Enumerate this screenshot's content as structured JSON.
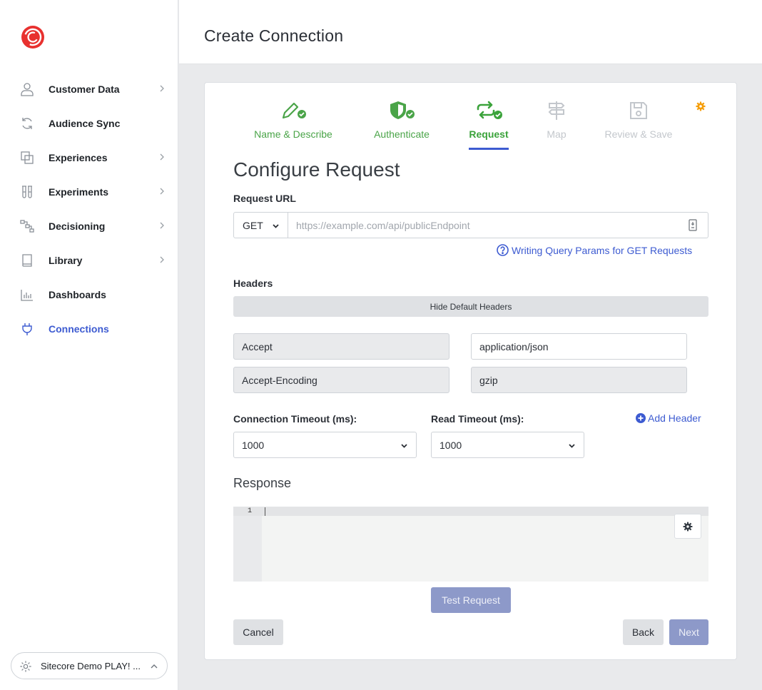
{
  "sidebar": {
    "items": [
      {
        "label": "Customer Data",
        "icon": "user-icon",
        "has_chevron": true
      },
      {
        "label": "Audience Sync",
        "icon": "sync-icon",
        "has_chevron": false
      },
      {
        "label": "Experiences",
        "icon": "experiences-icon",
        "has_chevron": true
      },
      {
        "label": "Experiments",
        "icon": "flask-icon",
        "has_chevron": true
      },
      {
        "label": "Decisioning",
        "icon": "flow-icon",
        "has_chevron": true
      },
      {
        "label": "Library",
        "icon": "book-icon",
        "has_chevron": true
      },
      {
        "label": "Dashboards",
        "icon": "chart-icon",
        "has_chevron": false
      },
      {
        "label": "Connections",
        "icon": "plug-icon",
        "has_chevron": false,
        "active": true
      }
    ],
    "org_label": "Sitecore Demo PLAY! ..."
  },
  "header": {
    "title": "Create Connection"
  },
  "steps": [
    {
      "label": "Name & Describe",
      "state": "done"
    },
    {
      "label": "Authenticate",
      "state": "done"
    },
    {
      "label": "Request",
      "state": "current"
    },
    {
      "label": "Map",
      "state": "todo"
    },
    {
      "label": "Review & Save",
      "state": "todo"
    }
  ],
  "form": {
    "title": "Configure Request",
    "request_url_label": "Request URL",
    "method": "GET",
    "url_placeholder": "https://example.com/api/publicEndpoint",
    "url_value": "",
    "help_link": "Writing Query Params for GET Requests",
    "headers_label": "Headers",
    "hide_default_headers": "Hide Default Headers",
    "headers": [
      {
        "key": "Accept",
        "value": "application/json"
      },
      {
        "key": "Accept-Encoding",
        "value": "gzip"
      }
    ],
    "add_header": "Add Header",
    "connection_timeout_label": "Connection Timeout (ms):",
    "connection_timeout": "1000",
    "read_timeout_label": "Read Timeout (ms):",
    "read_timeout": "1000",
    "response_label": "Response",
    "editor_line_number": "1",
    "test_request": "Test Request",
    "cancel": "Cancel",
    "back": "Back",
    "next": "Next"
  },
  "colors": {
    "accent": "#3d5bd1",
    "done_green": "#4aa448",
    "disabled_primary": "#8d99c9",
    "brand_red": "#e8312f",
    "settings_orange": "#f59e0b"
  }
}
